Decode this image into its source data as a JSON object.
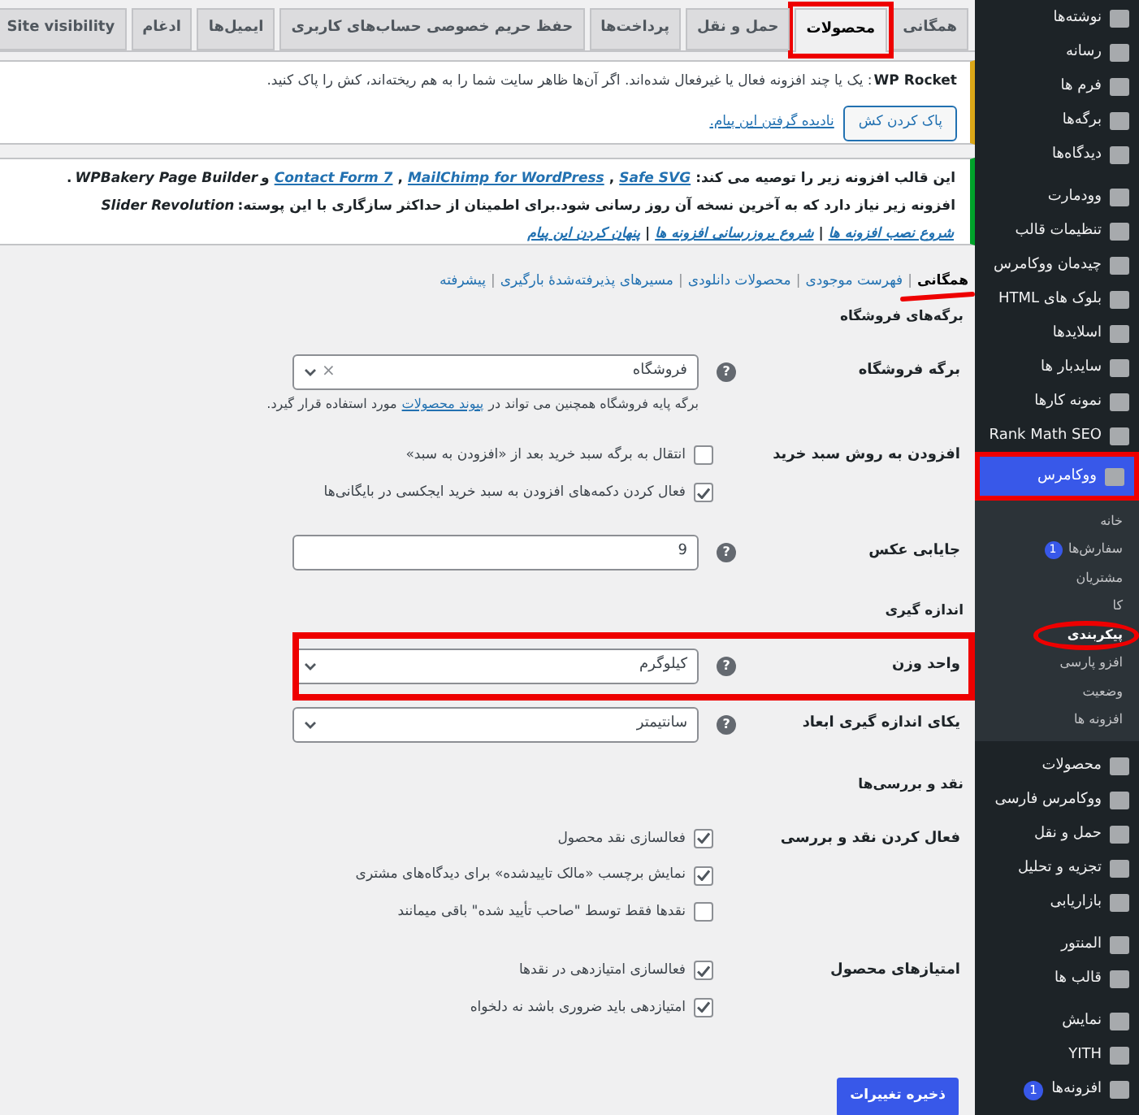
{
  "tabs": [
    {
      "label": "همگانی",
      "selected": false
    },
    {
      "label": "محصولات",
      "selected": true
    },
    {
      "label": "حمل و نقل",
      "selected": false
    },
    {
      "label": "پرداخت‌ها",
      "selected": false
    },
    {
      "label": "حفظ حریم خصوصی حساب‌های کاربری",
      "selected": false
    },
    {
      "label": "ایمیل‌ها",
      "selected": false
    },
    {
      "label": "ادغام",
      "selected": false
    },
    {
      "label": "Site visibility",
      "selected": false
    }
  ],
  "notices": [
    {
      "kind": "warning",
      "lines": [
        [
          {
            "kind": "bold",
            "text": "WP Rocket"
          },
          {
            "kind": "text",
            "text": ": یک یا چند افزونه فعال یا غیرفعال شده‌اند. اگر آن‌ها ظاهر سایت شما را به هم ریخته‌اند، کش را پاک کنید."
          }
        ]
      ],
      "button": "پاک کردن کش",
      "dismiss": "نادیده گرفتن این پیام."
    },
    {
      "kind": "success",
      "lines": [
        [
          {
            "kind": "text",
            "text": "این قالب افزونه زیر را توصیه می کند:"
          },
          {
            "kind": "link",
            "text": "Safe SVG"
          },
          {
            "kind": "text",
            "text": ","
          },
          {
            "kind": "link",
            "text": "MailChimp for WordPress"
          },
          {
            "kind": "text",
            "text": ","
          },
          {
            "kind": "link",
            "text": "Contact Form 7"
          },
          {
            "kind": "text",
            "text": "و"
          },
          {
            "kind": "em",
            "text": "WPBakery Page Builder"
          },
          {
            "kind": "text",
            "text": "."
          }
        ],
        [
          {
            "kind": "text",
            "text": "افزونه زیر نیاز دارد که به آخرین نسخه آن روز رسانی شود.برای اطمینان از حداکثر سازگاری با این پوسته:"
          },
          {
            "kind": "em",
            "text": "Slider Revolution"
          }
        ],
        [
          {
            "kind": "link",
            "text": "شروع نصب افزونه ها"
          },
          {
            "kind": "text",
            "text": "|"
          },
          {
            "kind": "link",
            "text": "شروع بروزرسانی افزونه ها"
          },
          {
            "kind": "text",
            "text": "|"
          },
          {
            "kind": "link",
            "text": "پنهان کردن این پیام"
          }
        ]
      ]
    }
  ],
  "subnav": {
    "separator": "|",
    "items": [
      {
        "label": "همگانی",
        "selected": true
      },
      {
        "label": "فهرست موجودی",
        "selected": false
      },
      {
        "label": "محصولات دانلودی",
        "selected": false
      },
      {
        "label": "مسیرهای پذیرفته‌شدهٔ بارگیری",
        "selected": false
      },
      {
        "label": "پیشرفته",
        "selected": false
      }
    ]
  },
  "sections": [
    {
      "title": "برگه‌های فروشگاه",
      "rows": [
        {
          "kind": "select",
          "label": "برگه فروشگاه",
          "help": "?",
          "value": "فروشگاه",
          "clear": "×",
          "description": [
            {
              "kind": "text",
              "text": "برگه پایه فروشگاه همچنین می تواند در"
            },
            {
              "kind": "link",
              "text": "پیوند محصولات"
            },
            {
              "kind": "text",
              "text": "مورد استفاده قرار گیرد."
            }
          ]
        },
        {
          "kind": "checks",
          "label": "افزودن به روش سبد خرید",
          "options": [
            {
              "text": "انتقال به برگه سبد خرید بعد از «افزودن به سبد»",
              "checked": false
            },
            {
              "text": "فعال کردن دکمه‌های افزودن به سبد خرید ایجکسی در بایگانی‌ها",
              "checked": true
            }
          ]
        },
        {
          "kind": "input",
          "label": "جایابی عکس",
          "help": "?",
          "value": "9"
        }
      ]
    },
    {
      "title": "اندازه گیری",
      "rows": [
        {
          "kind": "select",
          "label": "واحد وزن",
          "help": "?",
          "value": "کیلوگرم"
        },
        {
          "kind": "select",
          "label": "یکای اندازه گیری ابعاد",
          "help": "?",
          "value": "سانتیمتر"
        }
      ]
    },
    {
      "title": "نقد و بررسی‌ها",
      "rows": [
        {
          "kind": "checks",
          "label": "فعال کردن نقد و بررسی",
          "options": [
            {
              "text": "فعالسازی نقد محصول",
              "checked": true
            },
            {
              "text": "نمایش برچسب «مالک تاییدشده» برای دیدگاه‌های مشتری",
              "checked": true
            },
            {
              "text": "نقدها فقط توسط \"صاحب تأیید شده\" باقی میمانند",
              "checked": false
            }
          ]
        },
        {
          "kind": "checks",
          "label": "امتیازهای محصول",
          "options": [
            {
              "text": "فعالسازی امتیازدهی در نقدها",
              "checked": true
            },
            {
              "text": "امتیازدهی باید ضروری باشد نه دلخواه",
              "checked": true
            }
          ]
        }
      ]
    }
  ],
  "save_button": "ذخیره تغییرات",
  "sidebar": {
    "groups": [
      [
        {
          "label": "نوشته‌ها"
        },
        {
          "label": "رسانه"
        },
        {
          "label": "فرم ها"
        },
        {
          "label": "برگه‌ها"
        },
        {
          "label": "دیدگاه‌ها"
        }
      ],
      [
        {
          "label": "وودمارت"
        },
        {
          "label": "تنظیمات قالب"
        },
        {
          "label": "چیدمان ووکامرس"
        },
        {
          "label": "بلوک های HTML"
        },
        {
          "label": "اسلایدها"
        },
        {
          "label": "سایدبار ها"
        },
        {
          "label": "نمونه کارها"
        },
        {
          "label": "Rank Math SEO"
        },
        {
          "label": "ووکامرس",
          "selected": true,
          "children": [
            {
              "label": "خانه",
              "selected": false
            },
            {
              "label": "سفارش‌ها",
              "badge": "1",
              "selected": false
            },
            {
              "label": "مشتریان",
              "selected": false
            },
            {
              "label": "کا",
              "selected": false
            },
            {
              "label": "پیکربندی",
              "selected": true
            },
            {
              "label": "افزو پارسی",
              "selected": false
            },
            {
              "label": "وضعیت",
              "selected": false
            },
            {
              "label": "افزونه ها",
              "selected": false
            }
          ]
        }
      ],
      [
        {
          "label": "محصولات"
        },
        {
          "label": "ووکامرس فارسی"
        },
        {
          "label": "حمل و نقل"
        },
        {
          "label": "تجزیه و تحلیل"
        },
        {
          "label": "بازاریابی"
        }
      ],
      [
        {
          "label": "المنتور"
        },
        {
          "label": "قالب ها"
        }
      ],
      [
        {
          "label": "نمایش"
        },
        {
          "label": "YITH"
        },
        {
          "label": "افزونه‌ها",
          "badge": "1"
        }
      ]
    ]
  }
}
